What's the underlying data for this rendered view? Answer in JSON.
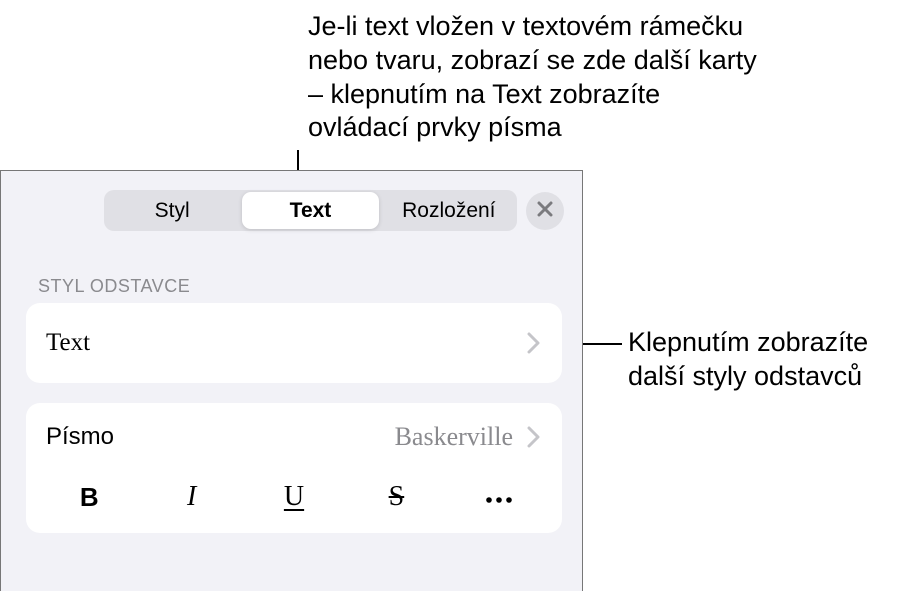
{
  "annotations": {
    "top": "Je-li text vložen v textovém rámečku nebo tvaru, zobrazí se zde další karty – klepnutím na Text zobrazíte ovládací prvky písma",
    "right": "Klepnutím zobrazíte další styly odstavců"
  },
  "tabs": {
    "style": "Styl",
    "text": "Text",
    "layout": "Rozložení"
  },
  "section_title": "STYL ODSTAVCE",
  "paragraph_style": {
    "name": "Text"
  },
  "font": {
    "label": "Písmo",
    "value": "Baskerville"
  },
  "format_buttons": {
    "bold": "B",
    "italic": "I",
    "underline": "U",
    "strike": "S"
  }
}
